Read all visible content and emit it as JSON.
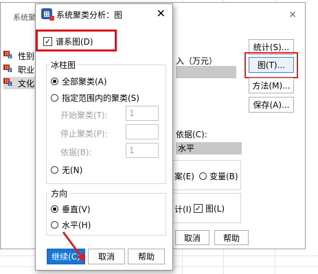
{
  "back_window": {
    "title": "系统聚",
    "top_cut_text": "",
    "variables": [
      {
        "label": "性别"
      },
      {
        "label": "职业"
      },
      {
        "label": "文化"
      }
    ],
    "income_label": "入（万元）",
    "buttons": {
      "stats": "统计(S)...",
      "plots": "图(T)...",
      "method": "方法(M)...",
      "save": "保存(A)..."
    },
    "label_by": "依据(C):",
    "label_field_value": "水平",
    "cluster_options": [
      "案(E)",
      "变量(B)"
    ],
    "display_options": [
      "计(I)",
      "图(L)"
    ],
    "bottom_buttons": [
      "取消",
      "帮助"
    ]
  },
  "dialog": {
    "title": "系统聚类分析：图",
    "dendrogram_label": "谱系图(D)",
    "icicle": {
      "group_title": "冰柱图",
      "all_clusters": "全部聚类(A)",
      "range_clusters": "指定范围内的聚类(S)",
      "start_label": "开始聚类(T):",
      "start_value": "1",
      "stop_label": "停止聚类(P):",
      "stop_value": "",
      "by_label": "依据(B):",
      "by_value": "1",
      "none": "无(N)"
    },
    "orientation": {
      "group_title": "方向",
      "vertical": "垂直(V)",
      "horizontal": "水平(H)"
    },
    "buttons": {
      "continue": "继续(C)",
      "cancel": "取消",
      "help": "帮助"
    }
  },
  "colors": {
    "highlight_red": "#e01e1e",
    "primary_blue": "#1976d2"
  }
}
